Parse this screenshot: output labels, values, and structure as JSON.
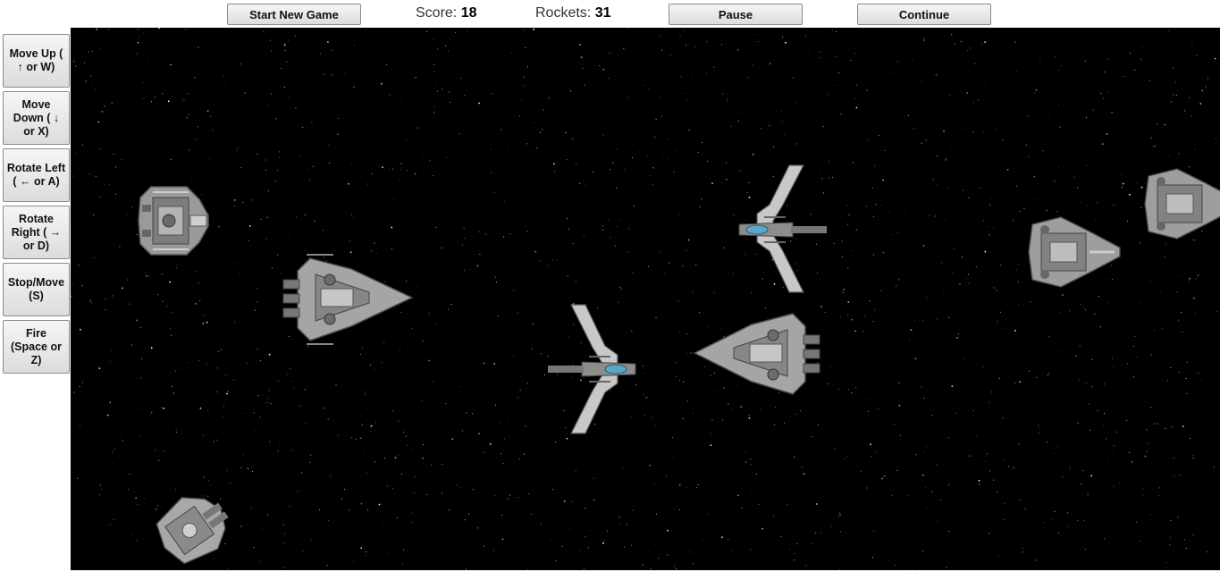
{
  "toolbar": {
    "start_new_game": "Start New Game",
    "score_label": "Score:",
    "score_value": "18",
    "rockets_label": "Rockets:",
    "rockets_value": "31",
    "pause": "Pause",
    "continue": "Continue"
  },
  "controls": {
    "move_up": "Move Up ( ↑ or W)",
    "move_down": "Move Down ( ↓ or X)",
    "rotate_left": "Rotate Left ( ← or A)",
    "rotate_right": "Rotate Right ( → or D)",
    "stop_move": "Stop/Move (S)",
    "fire": "Fire (Space or Z)"
  },
  "game": {
    "background_color": "#000000",
    "ships": [
      {
        "kind": "freighter",
        "facing": "right"
      },
      {
        "kind": "cruiser",
        "facing": "right"
      },
      {
        "kind": "fighter",
        "facing": "left"
      },
      {
        "kind": "fighter",
        "facing": "right"
      },
      {
        "kind": "cruiser",
        "facing": "left"
      },
      {
        "kind": "destroyer",
        "facing": "right"
      },
      {
        "kind": "destroyer",
        "facing": "right"
      },
      {
        "kind": "player-freighter",
        "facing": "up-right"
      }
    ]
  }
}
